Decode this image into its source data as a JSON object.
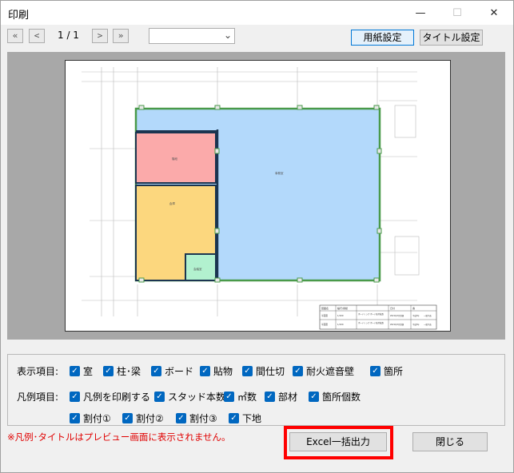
{
  "window": {
    "title": "印刷",
    "min_label": "—",
    "max_label": "☐",
    "close_label": "✕"
  },
  "toolbar": {
    "first_label": "«",
    "prev_label": "<",
    "page_indicator": "1 / 1",
    "next_label": ">",
    "last_label": "»",
    "combo_value": "",
    "paper_settings_label": "用紙設定",
    "title_settings_label": "タイトル設定"
  },
  "preview": {
    "room_labels": [
      "階段",
      "倉庫",
      "事務室",
      "会議室"
    ],
    "title_block": {
      "header": [
        "図面名",
        "縮尺/用紙",
        "日付",
        "番"
      ],
      "rows": [
        [
          "平面図",
          "1/100",
          "ボードリング ボード貼付枚数",
          "2021年5月登録",
          "平成3年",
          "一般平面"
        ],
        [
          "平面図",
          "1/100",
          "ボードリング ボード貼付枚数",
          "2021年5月登録",
          "平成3年",
          "一般平面"
        ]
      ]
    }
  },
  "options": {
    "display_label": "表示項目:",
    "display_items": [
      {
        "label": "室",
        "checked": true
      },
      {
        "label": "柱･梁",
        "checked": true
      },
      {
        "label": "ボード",
        "checked": true
      },
      {
        "label": "貼物",
        "checked": true
      },
      {
        "label": "間仕切",
        "checked": true
      },
      {
        "label": "耐火遮音壁",
        "checked": true
      },
      {
        "label": "箇所",
        "checked": true
      }
    ],
    "legend_label": "凡例項目:",
    "legend_items": [
      {
        "label": "凡例を印刷する",
        "checked": true
      },
      {
        "label": "スタッド本数",
        "checked": true
      },
      {
        "label": "㎡数",
        "checked": true
      },
      {
        "label": "部材",
        "checked": true
      },
      {
        "label": "箇所個数",
        "checked": true
      },
      {
        "label": "割付①",
        "checked": true
      },
      {
        "label": "割付②",
        "checked": true
      },
      {
        "label": "割付③",
        "checked": true
      },
      {
        "label": "下地",
        "checked": true
      }
    ]
  },
  "note": "※凡例･タイトルはプレビュー画面に表示されません。",
  "buttons": {
    "excel_label": "Excel一括出力",
    "close_label": "閉じる"
  },
  "colors": {
    "room_red": "#fbaaaa",
    "room_yellow": "#fcd77e",
    "room_blue": "#b3d9fb",
    "room_green": "#b2f1cf",
    "wall_green": "#4a9a4a",
    "highlight": "#ff0000",
    "checkbox": "#0067c0"
  }
}
